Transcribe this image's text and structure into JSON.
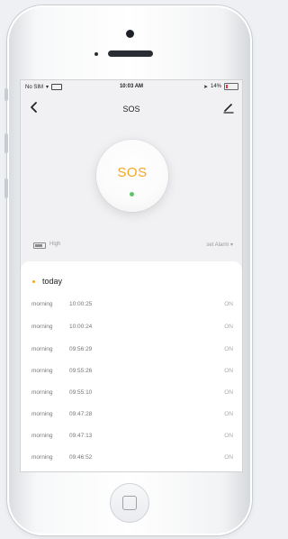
{
  "status_bar": {
    "carrier": "No SIM",
    "time": "10:03 AM",
    "battery": "14%"
  },
  "nav": {
    "title": "SOS",
    "back_icon": "chevron-left-icon",
    "edit_icon": "pencil-icon"
  },
  "sos_button": {
    "label": "SOS",
    "indicator_color": "#63c26a",
    "label_color": "#f5a623"
  },
  "device": {
    "battery_level": "High",
    "set_alarm": "set Alarm ▾"
  },
  "records": {
    "section_title": "today",
    "items": [
      {
        "period": "morning",
        "time": "10:00:25",
        "state": "ON"
      },
      {
        "period": "morning",
        "time": "10:00:24",
        "state": "ON"
      },
      {
        "period": "morning",
        "time": "09:56:29",
        "state": "ON"
      },
      {
        "period": "morning",
        "time": "09:55:26",
        "state": "ON"
      },
      {
        "period": "morning",
        "time": "09:55:10",
        "state": "ON"
      },
      {
        "period": "morning",
        "time": "09:47:28",
        "state": "ON"
      },
      {
        "period": "morning",
        "time": "09:47:13",
        "state": "ON"
      },
      {
        "period": "morning",
        "time": "09:46:52",
        "state": "ON"
      }
    ]
  }
}
